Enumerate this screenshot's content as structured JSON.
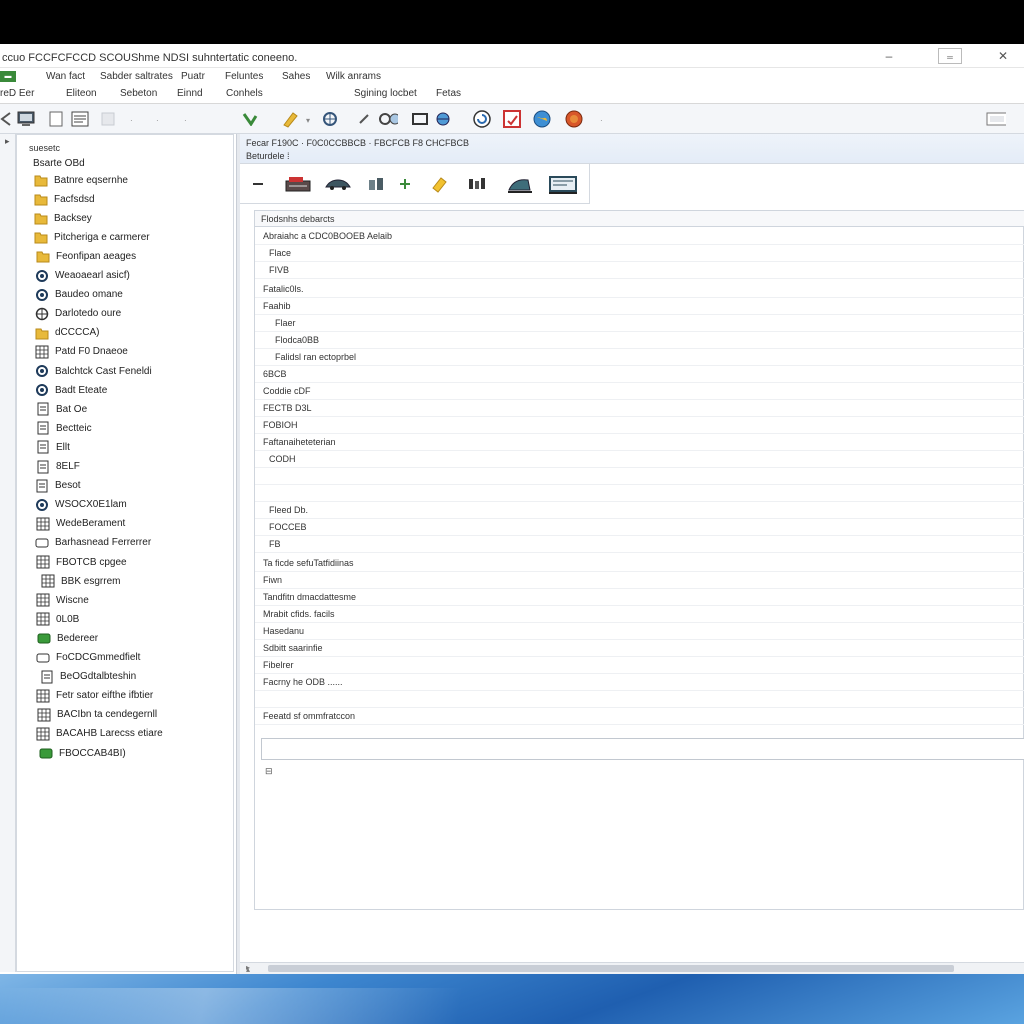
{
  "window": {
    "title": "ccuo FCCFCFCCD SCOUShme NDSI suhntertatic coneeno.",
    "controls": {
      "minimize": "–",
      "maximize": "☐",
      "close": "✕"
    }
  },
  "menu": {
    "items": [
      "Wan fact",
      "Sabder saltrates",
      "Puatr",
      "Feluntes",
      "Sahes",
      "Wilk anrams"
    ]
  },
  "secondbar": {
    "badge": "▬",
    "items": [
      "reD Eer",
      "Eliteon",
      "Sebeton",
      "Einnd",
      "Conhels",
      "Sgining locbet",
      "Fetas"
    ]
  },
  "tree": {
    "header": "suesetc",
    "root": "Bsarte OBd",
    "items": [
      {
        "label": "Batnre eqsernhe",
        "icon": "folder-icon"
      },
      {
        "label": "Facfsdsd",
        "icon": "folder-icon"
      },
      {
        "label": "Backsey",
        "icon": "folder-icon"
      },
      {
        "label": "Pitcheriga e carmerer",
        "icon": "folder-icon"
      },
      {
        "label": "Feonfipan aeages",
        "icon": "folder-icon"
      },
      {
        "label": "Weaoaearl asicf)",
        "icon": "gear-icon"
      },
      {
        "label": "Baudeo omane",
        "icon": "gear-icon"
      },
      {
        "label": "Darlotedo oure",
        "icon": "globe-icon"
      },
      {
        "label": "dCCCCA)",
        "icon": "folder-icon"
      },
      {
        "label": "Patd F0 Dnaeoe",
        "icon": "grid-icon"
      },
      {
        "label": "Balchtck Cast Feneldi",
        "icon": "gear-icon"
      },
      {
        "label": "Badt Eteate",
        "icon": "gear-icon"
      },
      {
        "label": "Bat Oe",
        "icon": "doc-icon"
      },
      {
        "label": "Bectteic",
        "icon": "doc-icon"
      },
      {
        "label": "Ellt",
        "icon": "doc-icon"
      },
      {
        "label": "8ELF",
        "icon": "doc-icon"
      },
      {
        "label": "Besot",
        "icon": "doc-icon"
      },
      {
        "label": "WSOCX0E1lam",
        "icon": "gear-icon"
      },
      {
        "label": "WedeBerament",
        "icon": "grid-icon"
      },
      {
        "label": "Barhasnead Ferrerrer",
        "icon": "drive-icon"
      },
      {
        "label": "FBOTCB cpgee",
        "icon": "grid-icon"
      },
      {
        "label": "BBK esgrrem",
        "icon": "grid-icon"
      },
      {
        "label": "Wiscne",
        "icon": "grid-icon"
      },
      {
        "label": "0L0B",
        "icon": "grid-icon"
      },
      {
        "label": "Bedereer",
        "icon": "green-icon"
      },
      {
        "label": "FoCDCGmmedfielt",
        "icon": "drive-icon"
      },
      {
        "label": "BeOGdtalbteshin",
        "icon": "doc-icon"
      },
      {
        "label": "Fetr sator eifthe ifbtier",
        "icon": "grid-icon"
      },
      {
        "label": "BACIbn ta cendegernll",
        "icon": "grid-icon"
      },
      {
        "label": "BACAHB Larecss etiare",
        "icon": "grid-icon"
      },
      {
        "label": "FBOCCAB4BI)",
        "icon": "green-icon"
      }
    ]
  },
  "breadcrumb": {
    "line1": "Fecar F190C  ·  F0C0CCBBCB  ·  FBCFCB F8 CHCFBCB",
    "line2": "Beturdele  ⁞"
  },
  "properties": {
    "header": "Flodsnhs debarcts",
    "rows": [
      {
        "label": "Abraiahc a CDC0BOOEB Aelaib",
        "indent": 0
      },
      {
        "label": "Flace",
        "indent": 1
      },
      {
        "label": "FIVB",
        "indent": 1
      },
      {
        "label": "Fatalic0ls.",
        "indent": 0
      },
      {
        "label": "Faahib",
        "indent": 0
      },
      {
        "label": "Flaer",
        "indent": 2
      },
      {
        "label": "Flodca0BB",
        "indent": 2
      },
      {
        "label": "Falidsl ran ectoprbel",
        "indent": 2
      },
      {
        "label": "6BCB",
        "indent": 0
      },
      {
        "label": "Coddie cDF",
        "indent": 0
      },
      {
        "label": "FECTB D3L",
        "indent": 0
      },
      {
        "label": "FOBIOH",
        "indent": 0
      },
      {
        "label": "Faftanaiheteterian",
        "indent": 0
      },
      {
        "label": "CODH",
        "indent": 1
      },
      {
        "label": "",
        "indent": 0
      },
      {
        "label": "",
        "indent": 0
      },
      {
        "label": "Fleed Db.",
        "indent": 1
      },
      {
        "label": "FOCCEB",
        "indent": 1
      },
      {
        "label": "FB",
        "indent": 1
      },
      {
        "label": "Ta ficde sefuTatfidiinas",
        "indent": 0
      },
      {
        "label": "Fiwn",
        "indent": 0
      },
      {
        "label": "Tandfitn dmacdattesme",
        "indent": 0
      },
      {
        "label": "Mrabit cfids. facils",
        "indent": 0
      },
      {
        "label": "Hasedanu",
        "indent": 0
      },
      {
        "label": "Sdbitt saarinfie",
        "indent": 0
      },
      {
        "label": "Fibelrer",
        "indent": 0
      },
      {
        "label": "Facrny he ODB ......",
        "indent": 0
      },
      {
        "label": "",
        "indent": 0
      },
      {
        "label": "Feeatd sf ommfratccon",
        "indent": 0
      }
    ],
    "edit_mark": "⊟"
  },
  "colors": {
    "folder": "#e8b93a",
    "accent_green": "#3a8a3a",
    "taskbar": "#2f74c2"
  }
}
